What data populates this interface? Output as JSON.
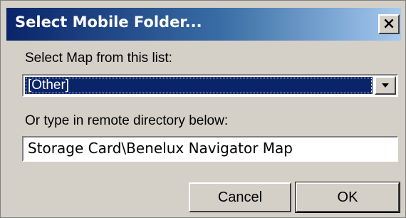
{
  "window": {
    "title": "Select Mobile Folder...",
    "close_label": "×"
  },
  "map_select": {
    "label": "Select Map from this list:",
    "selected_value": "[Other]"
  },
  "remote_dir": {
    "label": "Or type in remote directory below:",
    "value": "Storage Card\\Benelux Navigator Map"
  },
  "buttons": {
    "cancel_label": "Cancel",
    "ok_label": "OK"
  },
  "colors": {
    "titlebar_start": "#0a246a",
    "titlebar_end": "#a6caf0",
    "dialog_face": "#d4d0c8",
    "selection": "#0a246a"
  },
  "icons": {
    "close": "close-icon",
    "dropdown": "chevron-down-icon"
  }
}
